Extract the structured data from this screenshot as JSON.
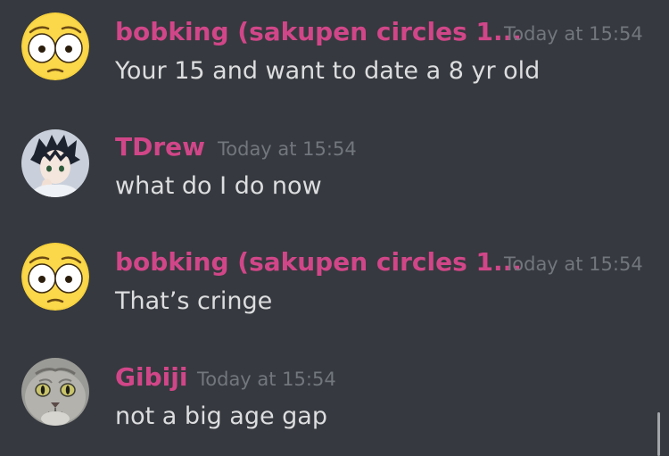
{
  "colors": {
    "background": "#36393f",
    "username": "#d14688",
    "timestamp": "#72767d",
    "message_text": "#dcddde"
  },
  "messages": [
    {
      "username": "bobking (sakupen circles 1...",
      "timestamp": "Today at 15:54",
      "text": "Your 15 and want to date a 8 yr old",
      "avatar_icon": "flushed-emoji-icon"
    },
    {
      "username": "TDrew",
      "timestamp": "Today at 15:54",
      "text": "what do I do now",
      "avatar_icon": "anime-boy-avatar-icon"
    },
    {
      "username": "bobking (sakupen circles 1...",
      "timestamp": "Today at 15:54",
      "text": "That’s cringe",
      "avatar_icon": "flushed-emoji-icon"
    },
    {
      "username": "Gibiji",
      "timestamp": "Today at 15:54",
      "text": "not a big age gap",
      "avatar_icon": "cat-avatar-icon"
    }
  ]
}
